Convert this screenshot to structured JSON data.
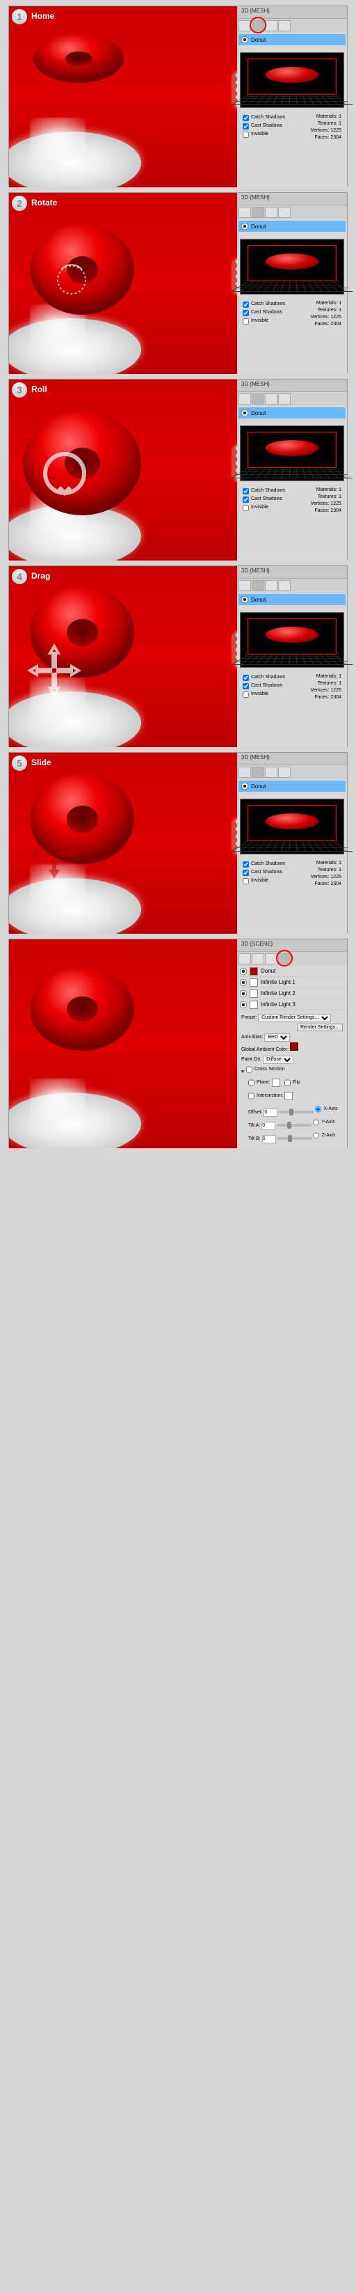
{
  "steps": [
    {
      "num": "1",
      "title": "Home",
      "mesh": "Donut",
      "catch_shadows": true,
      "cast_shadows": true,
      "invisible": false,
      "materials": "1",
      "textures": "1",
      "vertices": "1225",
      "faces": "2304"
    },
    {
      "num": "2",
      "title": "Rotate",
      "mesh": "Donut",
      "catch_shadows": true,
      "cast_shadows": true,
      "invisible": false,
      "materials": "1",
      "textures": "1",
      "vertices": "1225",
      "faces": "2304"
    },
    {
      "num": "3",
      "title": "Roll",
      "mesh": "Donut",
      "catch_shadows": true,
      "cast_shadows": true,
      "invisible": false,
      "materials": "1",
      "textures": "1",
      "vertices": "1225",
      "faces": "2304"
    },
    {
      "num": "4",
      "title": "Drag",
      "mesh": "Donut",
      "catch_shadows": true,
      "cast_shadows": true,
      "invisible": false,
      "materials": "1",
      "textures": "1",
      "vertices": "1225",
      "faces": "2304"
    },
    {
      "num": "5",
      "title": "Slide",
      "mesh": "Donut",
      "catch_shadows": true,
      "cast_shadows": true,
      "invisible": false,
      "materials": "1",
      "textures": "1",
      "vertices": "1225",
      "faces": "2304"
    }
  ],
  "panel_tab": "3D  {MESH}",
  "labels": {
    "catch_shadows": "Catch Shadows",
    "cast_shadows": "Cast Shadows",
    "invisible": "Invisible",
    "materials": "Materials:",
    "textures": "Textures:",
    "vertices": "Vertices:",
    "faces": "Faces:"
  },
  "scene": {
    "tab": "3D  {SCENE}",
    "layers": [
      {
        "name": "Donut",
        "color": "#b00000"
      },
      {
        "name": "Infinite Light 1",
        "color": "#ffffff"
      },
      {
        "name": "Infinite Light 2",
        "color": "#ffffff"
      },
      {
        "name": "Infinite Light 3",
        "color": "#ffffff"
      }
    ],
    "preset_label": "Preset:",
    "preset_value": "Custom Render Settings...",
    "render_settings_btn": "Render Settings...",
    "anti_alias_label": "Anti-Alias:",
    "anti_alias_value": "Best",
    "global_ambient_label": "Global Ambient Color:",
    "paint_on_label": "Paint On:",
    "paint_on_value": "Diffuse",
    "cross_section_label": "Cross Section",
    "plane_label": "Plane:",
    "intersection_label": "Intersection:",
    "offset_label": "Offset:",
    "offset_value": "0",
    "tilt_a_label": "Tilt A:",
    "tilt_a_value": "0",
    "tilt_b_label": "Tilt B:",
    "tilt_b_value": "0",
    "axis_x": "X-Axis",
    "axis_y": "Y-Axis",
    "axis_z": "Z-Axis",
    "flip": "Flip"
  }
}
